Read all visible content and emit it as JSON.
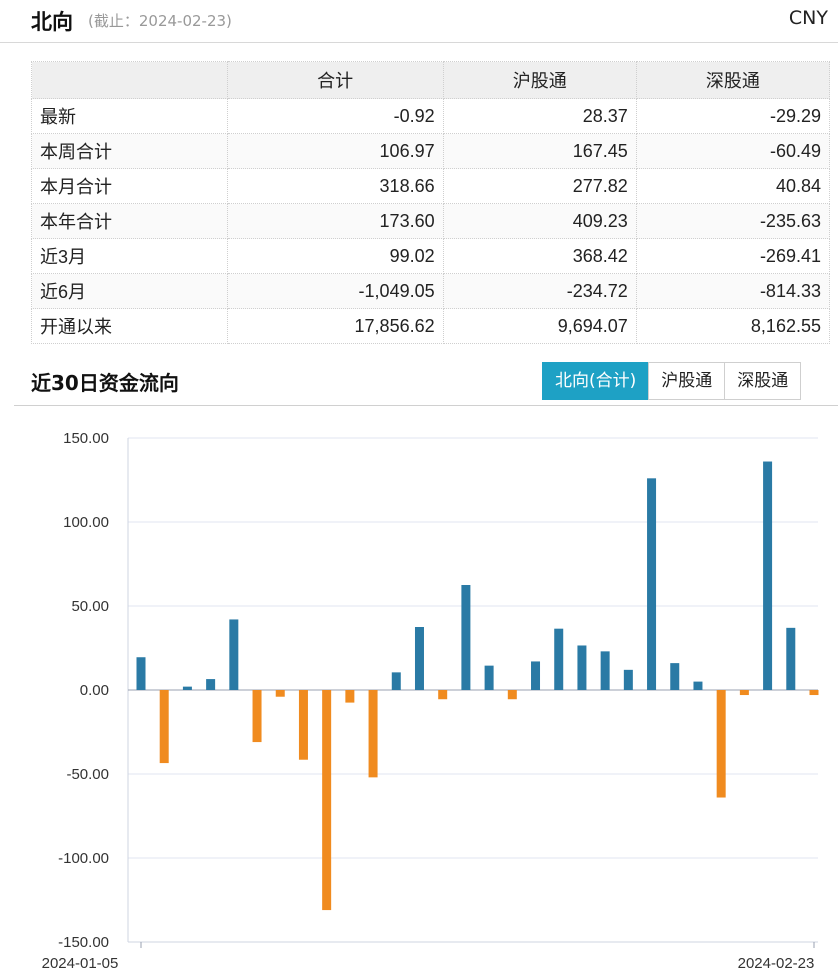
{
  "header": {
    "title": "北向",
    "as_of": "(截止：2024-02-23)",
    "currency": "CNY"
  },
  "summary": {
    "columns": [
      "",
      "合计",
      "沪股通",
      "深股通"
    ],
    "rows": [
      {
        "label": "最新",
        "total": "-0.92",
        "sh": "28.37",
        "sz": "-29.29"
      },
      {
        "label": "本周合计",
        "total": "106.97",
        "sh": "167.45",
        "sz": "-60.49"
      },
      {
        "label": "本月合计",
        "total": "318.66",
        "sh": "277.82",
        "sz": "40.84"
      },
      {
        "label": "本年合计",
        "total": "173.60",
        "sh": "409.23",
        "sz": "-235.63"
      },
      {
        "label": "近3月",
        "total": "99.02",
        "sh": "368.42",
        "sz": "-269.41"
      },
      {
        "label": "近6月",
        "total": "-1,049.05",
        "sh": "-234.72",
        "sz": "-814.33"
      },
      {
        "label": "开通以来",
        "total": "17,856.62",
        "sh": "9,694.07",
        "sz": "8,162.55"
      }
    ]
  },
  "section": {
    "title": "近30日资金流向",
    "tabs": [
      {
        "label": "北向(合计)",
        "active": true
      },
      {
        "label": "沪股通",
        "active": false
      },
      {
        "label": "深股通",
        "active": false
      }
    ]
  },
  "chart_data": {
    "type": "bar",
    "ylim": [
      -150,
      150
    ],
    "y_ticks": [
      "150.00",
      "100.00",
      "50.00",
      "0.00",
      "-50.00",
      "-100.00",
      "-150.00"
    ],
    "x_labels": [
      "2024-01-05",
      "2024-02-23"
    ],
    "colors": {
      "positive": "#2a7aa5",
      "negative": "#f08b1f"
    },
    "grid": true,
    "values": [
      19.5,
      -43.5,
      2,
      6.5,
      42,
      -31,
      -4,
      -41.5,
      -131,
      -7.5,
      -52,
      10.5,
      37.5,
      -5.5,
      62.5,
      14.5,
      -5.5,
      17,
      36.5,
      26.5,
      23,
      12,
      126,
      16,
      5,
      -64,
      -3,
      136,
      37,
      -3
    ]
  }
}
